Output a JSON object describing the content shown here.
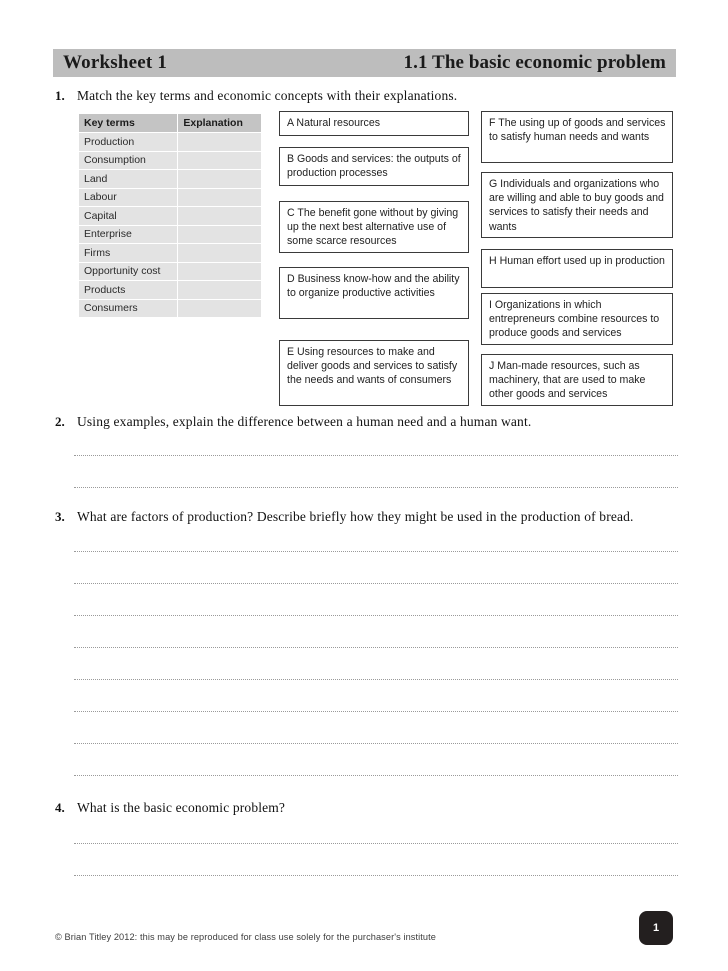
{
  "header": {
    "worksheet_label": "Worksheet 1",
    "topic_label": "1.1 The basic economic problem",
    "band_color": "#bdbdbd"
  },
  "questions": [
    {
      "number": "1.",
      "text": "Match the key terms and economic concepts with their explanations."
    },
    {
      "number": "2.",
      "text": "Using examples, explain the difference between a human need and a human want.",
      "answer_lines": 2
    },
    {
      "number": "3.",
      "text": "What are factors of production? Describe briefly how they might be used in the production of bread.",
      "answer_lines": 8
    },
    {
      "number": "4.",
      "text": "What is the basic economic problem?",
      "answer_lines": 2
    }
  ],
  "key_terms_table": {
    "headers": [
      "Key terms",
      "Explanation"
    ],
    "rows": [
      "Production",
      "Consumption",
      "Land",
      "Labour",
      "Capital",
      "Enterprise",
      "Firms",
      "Opportunity cost",
      "Products",
      "Consumers"
    ],
    "header_bg": "#c4c4c4",
    "row_bg": "#e3e3e3"
  },
  "concept_boxes": {
    "middle_column": [
      {
        "letter": "A",
        "text": "A Natural resources"
      },
      {
        "letter": "B",
        "text": "B Goods and services: the outputs of production processes"
      },
      {
        "letter": "C",
        "text": "C The benefit gone without by giving up the next best alternative use of some scarce resources"
      },
      {
        "letter": "D",
        "text": "D Business know-how and the ability to organize productive activities"
      },
      {
        "letter": "E",
        "text": "E Using resources to make and deliver goods and services to satisfy the needs and wants of consumers"
      }
    ],
    "right_column": [
      {
        "letter": "F",
        "text": "F The using up of goods and services to satisfy human needs and wants"
      },
      {
        "letter": "G",
        "text": "G Individuals and organizations who are willing and able to buy goods and services to satisfy their needs and wants"
      },
      {
        "letter": "H",
        "text": "H Human effort used up in production"
      },
      {
        "letter": "I",
        "text": "I Organizations in which entrepreneurs combine resources to produce goods and services"
      },
      {
        "letter": "J",
        "text": "J Man-made resources, such as machinery, that are used to make other goods and services"
      }
    ]
  },
  "footer": {
    "copyright": "© Brian Titley 2012: this may be reproduced for class use solely for the purchaser's institute",
    "page_number": "1"
  }
}
